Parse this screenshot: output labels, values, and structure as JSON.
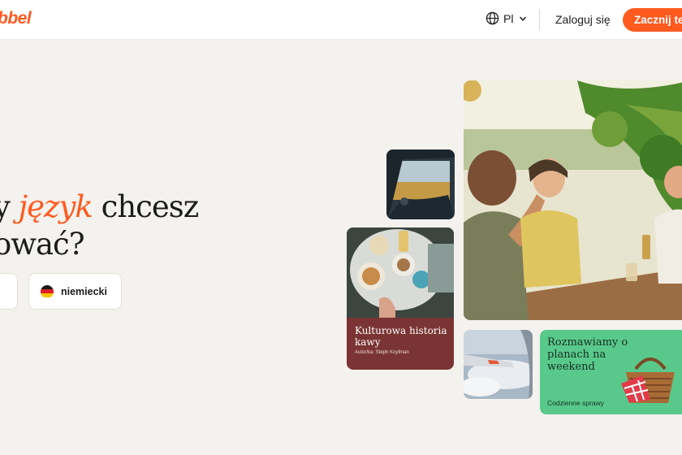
{
  "header": {
    "logo": "bbel",
    "language": "Pl",
    "login": "Zaloguj się",
    "cta": "Zacznij te"
  },
  "hero": {
    "headline_pre": "y ",
    "headline_accent": "język",
    "headline_post": " chcesz",
    "headline_line2": "ować?",
    "languages": [
      {
        "name": "niemiecki",
        "flag": "germany-flag-icon"
      }
    ]
  },
  "cards": {
    "coffee": {
      "title": "Kulturowa historia kawy",
      "author": "Autor/ka: Steph Koyfman"
    },
    "weekend": {
      "title": "Rozmawiamy o planach na weekend",
      "subtitle": "Codzienne sprawy"
    }
  },
  "colors": {
    "accent": "#ff5a1f",
    "background": "#f4f2ee",
    "coffee_card": "#7a3433",
    "weekend_card": "#59c98b"
  }
}
